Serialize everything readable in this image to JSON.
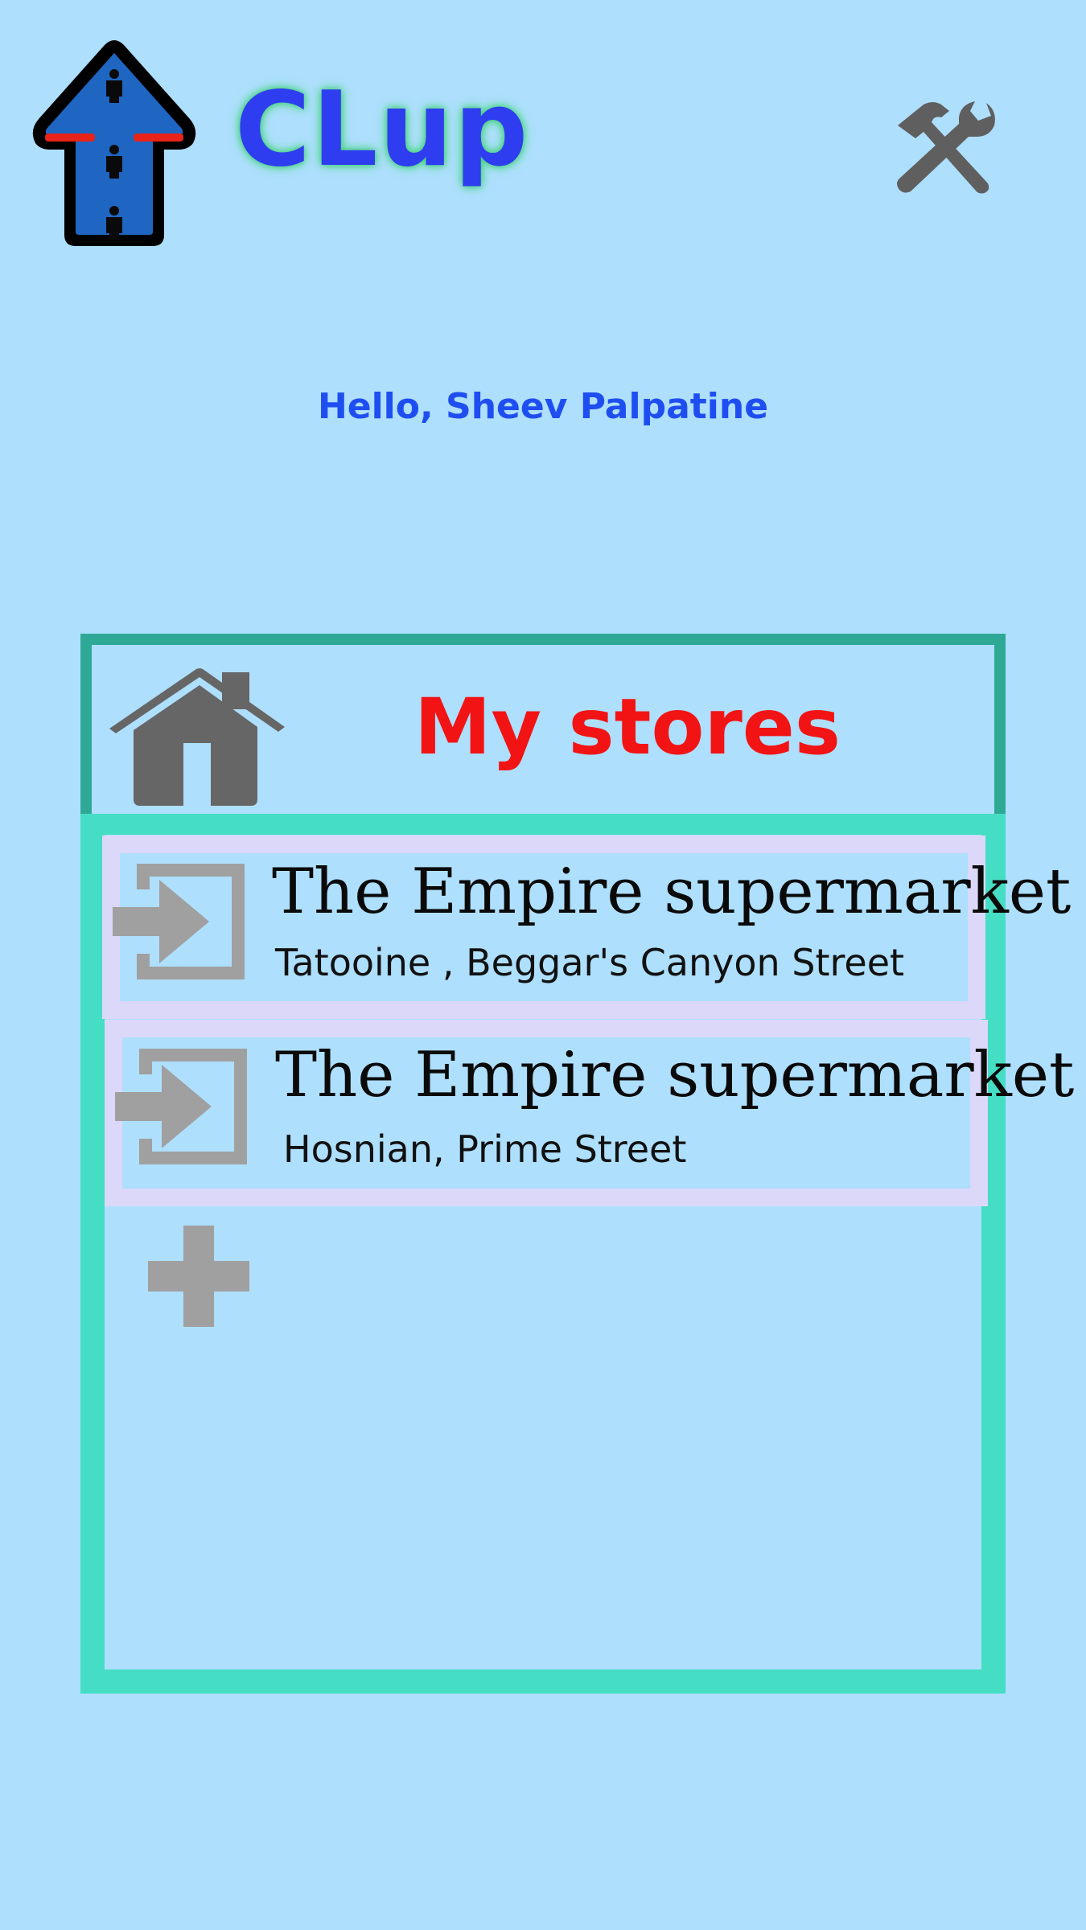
{
  "header": {
    "app_title": "CLup",
    "logo_icon": "up-arrow-queue-logo-icon",
    "settings_icon": "hammer-wrench-icon"
  },
  "greeting": "Hello, Sheev Palpatine",
  "panel": {
    "title": "My stores",
    "title_icon": "home-icon",
    "stores": [
      {
        "name": "The Empire supermarket",
        "address": "Tatooine , Beggar's Canyon Street",
        "icon": "enter-icon"
      },
      {
        "name": "The Empire supermarket",
        "address": "Hosnian, Prime Street",
        "icon": "enter-icon"
      }
    ],
    "add_icon": "plus-icon"
  },
  "colors": {
    "background": "#aedffd",
    "title_blue": "#2f3df0",
    "greeting_blue": "#1f4ef0",
    "panel_title_red": "#f21414",
    "panel_border": "#45dec4",
    "panel_header_border": "#2ea996",
    "card_border": "#dcd8f9",
    "icon_gray": "#a0a0a0",
    "home_gray": "#666666"
  }
}
